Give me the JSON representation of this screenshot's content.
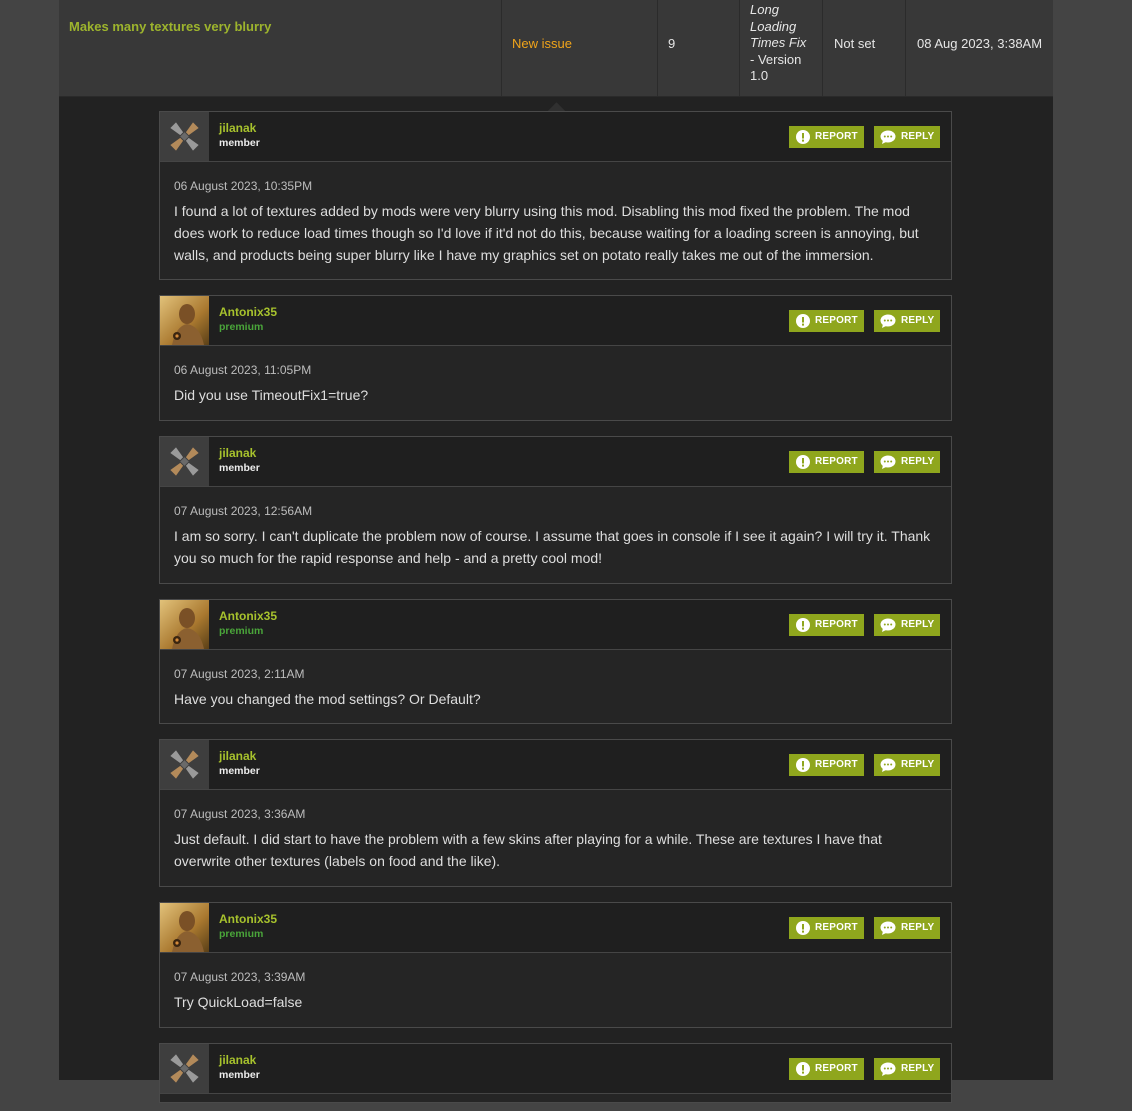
{
  "issue": {
    "title": "Makes many textures very blurry",
    "status": "New issue",
    "replies": "9",
    "version_lines": [
      "Long",
      "Loading",
      "Times Fix",
      "- Version",
      "1.0"
    ],
    "priority": "Not set",
    "last_post": "08 Aug 2023, 3:38AM"
  },
  "buttons": {
    "report": "REPORT",
    "reply": "REPLY"
  },
  "comments": [
    {
      "author": "jilanak",
      "role": "member",
      "date": "06 August 2023, 10:35PM",
      "text": "I found a lot of textures added by mods were very blurry using this mod. Disabling this mod fixed the problem. The mod does work to reduce load times though so I'd love if it'd not do this, because waiting for a loading screen is annoying, but walls, and products being super blurry like I have my graphics set on potato really takes me out of the immersion."
    },
    {
      "author": "Antonix35",
      "role": "premium",
      "date": "06 August 2023, 11:05PM",
      "text": "Did you use TimeoutFix1=true?"
    },
    {
      "author": "jilanak",
      "role": "member",
      "date": "07 August 2023, 12:56AM",
      "text": "I am so sorry. I can't duplicate the problem now of course. I assume that goes in console if I see it again? I will try it. Thank you so much for the rapid response and help - and a pretty cool mod!"
    },
    {
      "author": "Antonix35",
      "role": "premium",
      "date": "07 August 2023, 2:11AM",
      "text": "Have you changed the mod settings? Or Default?"
    },
    {
      "author": "jilanak",
      "role": "member",
      "date": "07 August 2023, 3:36AM",
      "text": "Just default. I did start to have the problem with a few skins after playing for a while. These are textures I have that overwrite other textures (labels on food and the like)."
    },
    {
      "author": "Antonix35",
      "role": "premium",
      "date": "07 August 2023, 3:39AM",
      "text": "Try QuickLoad=false"
    },
    {
      "author": "jilanak",
      "role": "member",
      "date": "",
      "text": ""
    }
  ],
  "colors": {
    "accent_green": "#8fa61d",
    "author_green": "#a7c22d",
    "premium_green": "#4aa53a",
    "status_orange": "#f0a41a"
  },
  "icons": [
    "report-icon",
    "reply-icon",
    "member-avatar-icon",
    "premium-avatar"
  ]
}
